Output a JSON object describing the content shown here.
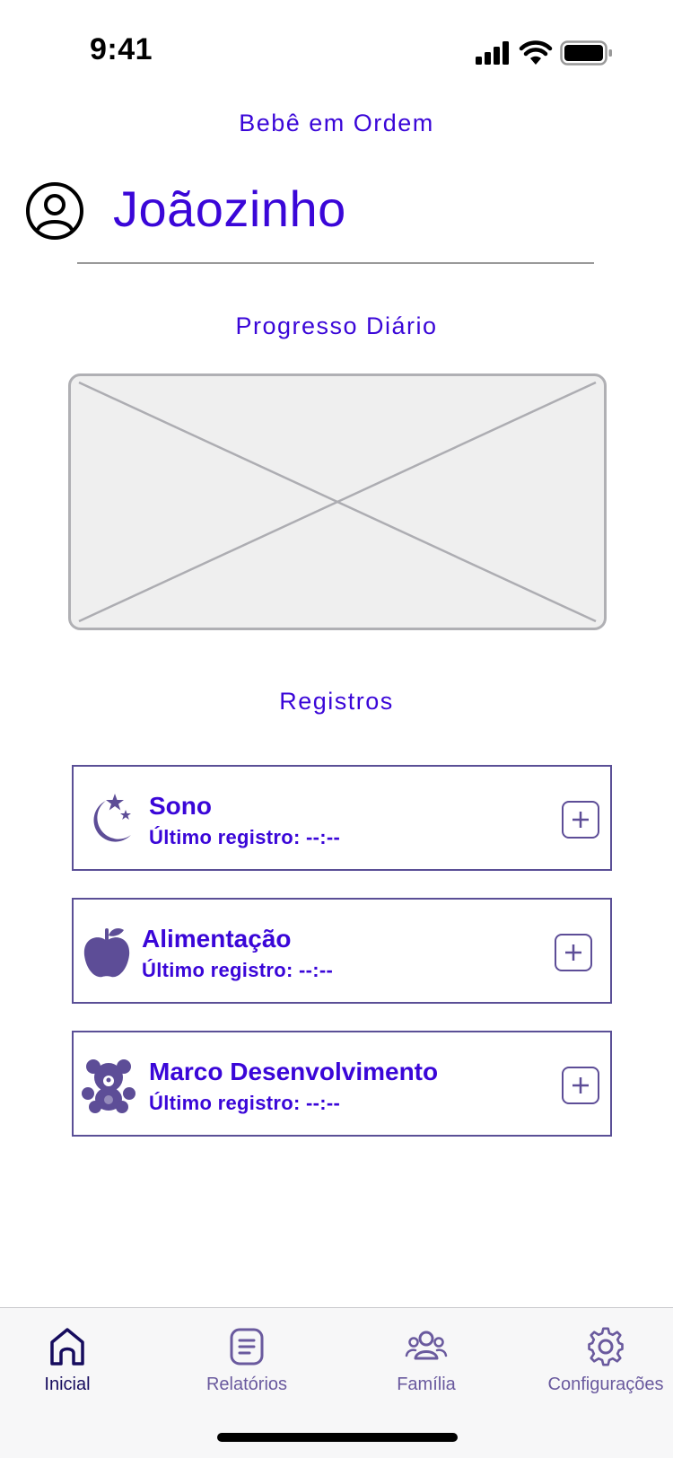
{
  "status_bar": {
    "time": "9:41"
  },
  "header": {
    "app_title": "Bebê em Ordem",
    "profile_name": "Joãozinho"
  },
  "progress": {
    "title": "Progresso Diário"
  },
  "records": {
    "title": "Registros",
    "items": [
      {
        "icon": "moon-stars-icon",
        "title": "Sono",
        "last_record": "Último registro: --:--"
      },
      {
        "icon": "apple-icon",
        "title": "Alimentação",
        "last_record": "Último registro: --:--"
      },
      {
        "icon": "teddy-bear-icon",
        "title": "Marco Desenvolvimento",
        "last_record": "Último registro: --:--"
      }
    ]
  },
  "tabbar": {
    "items": [
      {
        "icon": "home-icon",
        "label": "Inicial",
        "active": true
      },
      {
        "icon": "report-icon",
        "label": "Relatórios",
        "active": false
      },
      {
        "icon": "family-icon",
        "label": "Família",
        "active": false
      },
      {
        "icon": "settings-icon",
        "label": "Configurações",
        "active": false
      }
    ]
  },
  "colors": {
    "accent": "#3a06d8",
    "icon": "#5d4d97",
    "tab_active": "#160c5e"
  }
}
